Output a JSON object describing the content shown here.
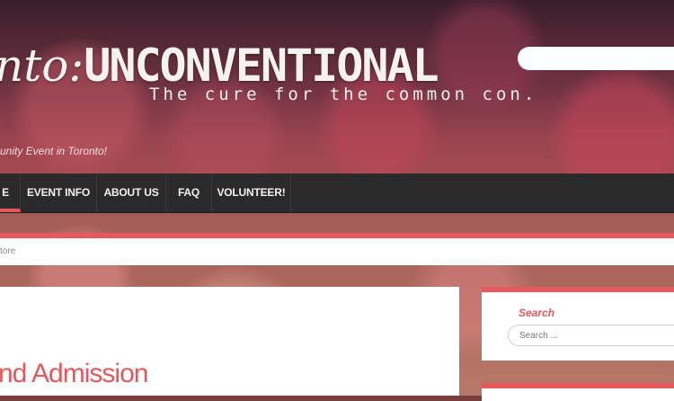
{
  "header": {
    "logo_prefix": "nto:",
    "logo_main": "UNCONVENTIONAL",
    "tagline": "The cure for the common con.",
    "description": "unity Event in Toronto!"
  },
  "nav": {
    "items": [
      {
        "label": "E"
      },
      {
        "label": "EVENT INFO"
      },
      {
        "label": "ABOUT US"
      },
      {
        "label": "FAQ"
      },
      {
        "label": "VOLUNTEER!"
      }
    ]
  },
  "breadcrumb": {
    "text": "tore"
  },
  "main": {
    "title": "nd Admission"
  },
  "sidebar": {
    "search_title": "Search",
    "search_placeholder": "Search ..."
  },
  "colors": {
    "accent": "#e5585b",
    "nav_bg": "#2b2a2a"
  }
}
